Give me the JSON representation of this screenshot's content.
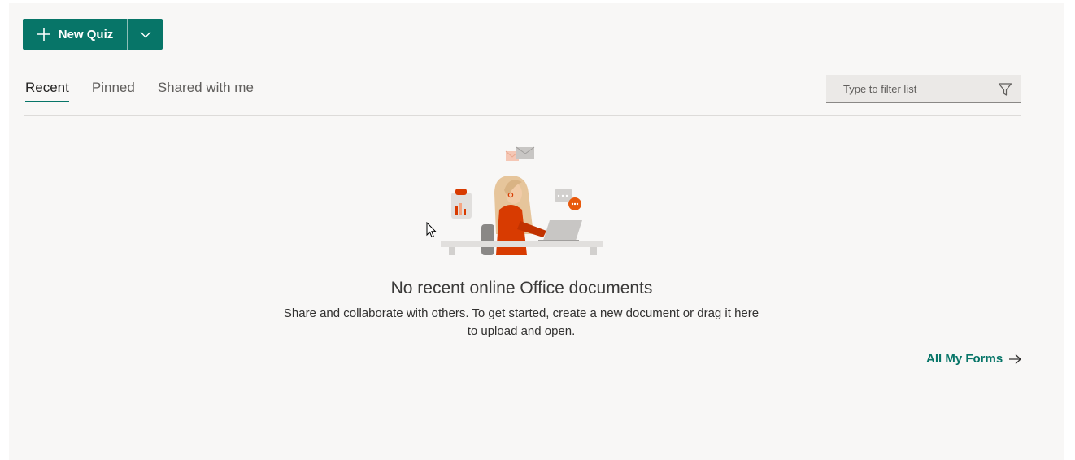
{
  "toolbar": {
    "new_button_label": "New Quiz",
    "accent_color": "#077568"
  },
  "tabs": [
    {
      "label": "Recent",
      "active": true
    },
    {
      "label": "Pinned",
      "active": false
    },
    {
      "label": "Shared with me",
      "active": false
    }
  ],
  "filter": {
    "placeholder": "Type to filter list",
    "value": "",
    "icon": "filter-icon"
  },
  "empty_state": {
    "title": "No recent online Office documents",
    "line1": "Share and collaborate with others. To get started, create a new document or drag it here",
    "line2": "to upload and open."
  },
  "footer_link": {
    "label": "All My Forms",
    "icon": "arrow-right-icon"
  }
}
